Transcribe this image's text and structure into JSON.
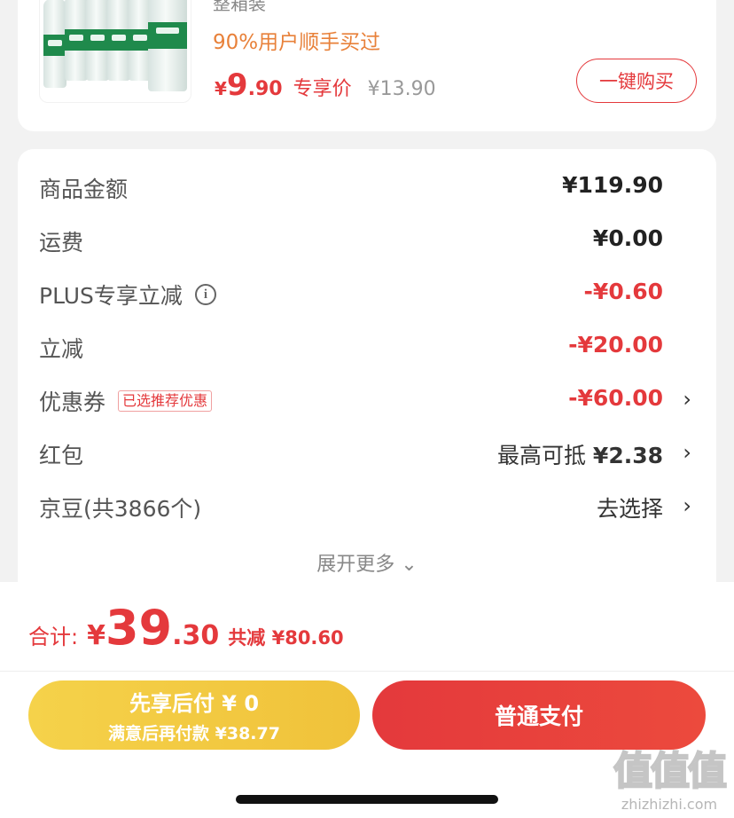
{
  "product": {
    "package_label": "整箱装",
    "buyers_note": "90%用户顺手买过",
    "price": {
      "currency": "¥",
      "integer": "9",
      "decimal": ".90",
      "tag": "专享价",
      "original": "¥13.90"
    },
    "buy_button": "一键购买"
  },
  "summary": {
    "rows": [
      {
        "label": "商品金额",
        "value": "¥119.90",
        "color": "normal"
      },
      {
        "label": "运费",
        "value": "¥0.00",
        "color": "normal"
      },
      {
        "label": "PLUS专享立减",
        "value": "-¥0.60",
        "color": "red"
      },
      {
        "label": "立减",
        "value": "-¥20.00",
        "color": "red"
      },
      {
        "label": "优惠券",
        "badge": "已选推荐优惠",
        "value": "-¥60.00",
        "color": "red"
      },
      {
        "label": "红包",
        "value_prefix": "最高可抵",
        "value": "¥2.38",
        "color": "normal"
      },
      {
        "label": "京豆(共3866个)",
        "value": "去选择",
        "color": "normal"
      }
    ],
    "expand_more": "展开更多"
  },
  "checkout": {
    "total_label": "合计:",
    "total_currency": "¥",
    "total_integer": "39",
    "total_decimal": ".30",
    "saved_text": "共减 ¥80.60",
    "pay_later_line1": "先享后付 ¥ 0",
    "pay_later_line2": "满意后再付款 ¥38.77",
    "pay_button": "普通支付"
  },
  "watermark": {
    "logo": "值值值",
    "site": "zhizhizhi.com"
  },
  "colors": {
    "accent_red": "#e4393c",
    "orange": "#e8813a",
    "gold": "#f0c23a"
  }
}
